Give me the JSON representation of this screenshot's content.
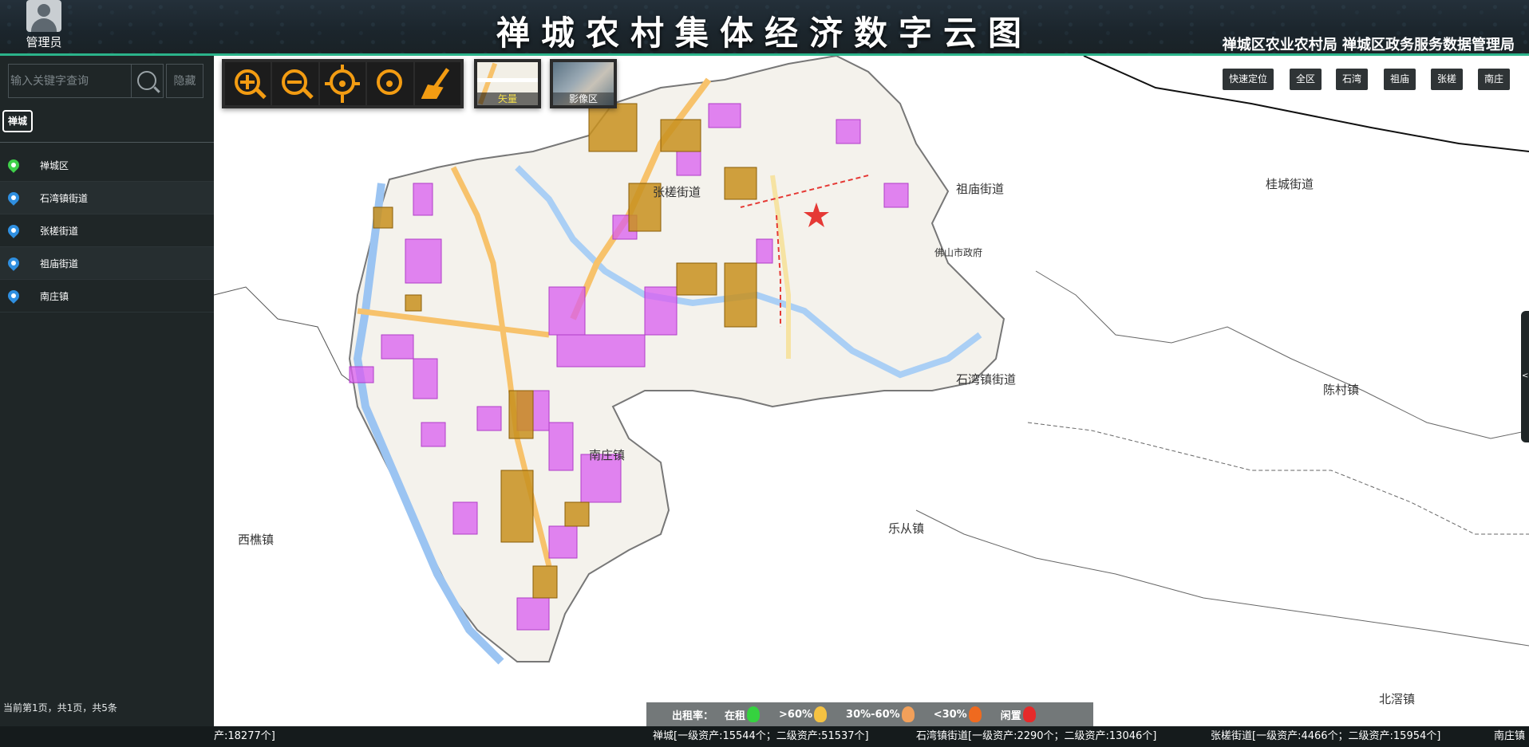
{
  "header": {
    "title": "禅城农村集体经济数字云图",
    "user_name": "管理员",
    "org": "禅城区农业农村局  禅城区政务服务数据管理局"
  },
  "sidebar": {
    "search_placeholder": "输入关键字查询",
    "hide_label": "隐藏",
    "tag": "禅城",
    "items": [
      {
        "label": "禅城区",
        "pin": "green-pin-icon"
      },
      {
        "label": "石湾镇街道",
        "pin": "blue-pin-icon"
      },
      {
        "label": "张槎街道",
        "pin": "blue-pin-icon"
      },
      {
        "label": "祖庙街道",
        "pin": "blue-pin-icon"
      },
      {
        "label": "南庄镇",
        "pin": "blue-pin-icon"
      }
    ],
    "pager": "当前第1页，共1页，共5条"
  },
  "map": {
    "basemaps": {
      "vector": "矢量",
      "image": "影像区"
    },
    "quick_buttons": [
      "快速定位",
      "全区",
      "石湾",
      "祖庙",
      "张槎",
      "南庄"
    ],
    "district_labels": {
      "guicheng": "桂城街道",
      "chencun": "陈村镇",
      "lecong": "乐从镇",
      "xiqiao": "西樵镇",
      "beijiao": "北滘镇",
      "zhangcha": "张槎街道",
      "zumiao": "祖庙街道",
      "shiwan": "石湾镇街道",
      "nanzhuang": "南庄镇",
      "government": "佛山市政府"
    },
    "right_handle": "<"
  },
  "legend": {
    "title": "出租率：",
    "items": [
      {
        "label": "在租",
        "color": "#35d23f"
      },
      {
        "label": ">60%",
        "color": "#f5c242"
      },
      {
        "label": "30%-60%",
        "color": "#f2a05a"
      },
      {
        "label": "<30%",
        "color": "#ef6a1f"
      },
      {
        "label": "闲置",
        "color": "#e62a2a"
      }
    ]
  },
  "ticker": [
    "产:18277个]",
    "禅城[一级资产:15544个；二级资产:51537个]",
    "石湾镇街道[一级资产:2290个；二级资产:13046个]",
    "张槎街道[一级资产:4466个；二级资产:15954个]",
    "南庄镇"
  ],
  "colors": {
    "accent": "#2bb38a",
    "parcel_purple": "#d95cf0",
    "parcel_orange": "#c8911e"
  }
}
